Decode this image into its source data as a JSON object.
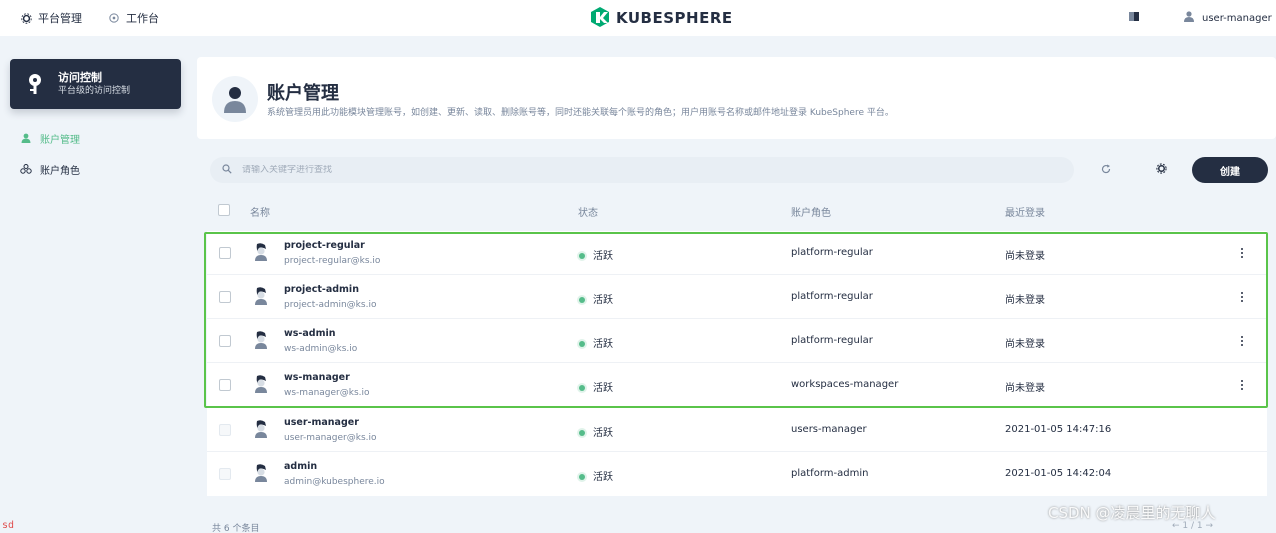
{
  "topbar": {
    "platform_label": "平台管理",
    "workbench_label": "工作台",
    "logo_text": "KUBESPHERE",
    "user_label": "user-manager"
  },
  "sidebar": {
    "card_title": "访问控制",
    "card_subtitle": "平台级的访问控制",
    "items": [
      {
        "label": "账户管理",
        "active": true
      },
      {
        "label": "账户角色",
        "active": false
      }
    ]
  },
  "header": {
    "title": "账户管理",
    "description": "系统管理员用此功能模块管理账号，如创建、更新、读取、删除账号等，同时还能关联每个账号的角色；用户用账号名称或邮件地址登录 KubeSphere 平台。"
  },
  "toolbar": {
    "search_placeholder": "请输入关键字进行查找",
    "create_label": "创建"
  },
  "table": {
    "columns": [
      "名称",
      "状态",
      "账户角色",
      "最近登录"
    ],
    "rows": [
      {
        "name": "project-regular",
        "email": "project-regular@ks.io",
        "status": "活跃",
        "role": "platform-regular",
        "last_login": "尚未登录"
      },
      {
        "name": "project-admin",
        "email": "project-admin@ks.io",
        "status": "活跃",
        "role": "platform-regular",
        "last_login": "尚未登录"
      },
      {
        "name": "ws-admin",
        "email": "ws-admin@ks.io",
        "status": "活跃",
        "role": "platform-regular",
        "last_login": "尚未登录"
      },
      {
        "name": "ws-manager",
        "email": "ws-manager@ks.io",
        "status": "活跃",
        "role": "workspaces-manager",
        "last_login": "尚未登录"
      },
      {
        "name": "user-manager",
        "email": "user-manager@ks.io",
        "status": "活跃",
        "role": "users-manager",
        "last_login": "2021-01-05 14:47:16"
      },
      {
        "name": "admin",
        "email": "admin@kubesphere.io",
        "status": "活跃",
        "role": "platform-admin",
        "last_login": "2021-01-05 14:42:04"
      }
    ]
  },
  "footer": {
    "total": "共 6 个条目",
    "pager": "1 / 1"
  },
  "overlay": {
    "watermark": "CSDN @凌晨里的无聊人",
    "corner_text": "sd"
  },
  "colors": {
    "brand_dark": "#242e42",
    "status_active": "#55bc8a",
    "highlight": "#5ac44a",
    "background": "#eff4f9"
  },
  "icons": [
    "gear-icon",
    "globe-icon",
    "kubesphere-logo-icon",
    "screen-icon",
    "user-icon",
    "key-icon",
    "user-group-icon",
    "search-icon",
    "refresh-icon",
    "settings-icon",
    "more-icon"
  ]
}
